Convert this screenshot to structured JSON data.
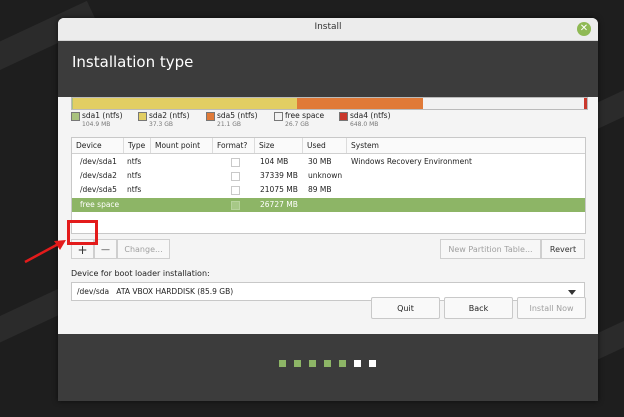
{
  "window": {
    "title": "Install"
  },
  "header": {
    "title": "Installation type"
  },
  "partition_bar": {
    "segments": [
      {
        "name": "sda1",
        "fraction": 0.0025,
        "color": "#a9c27e"
      },
      {
        "name": "sda2",
        "fraction": 0.4346,
        "color": "#e2ce63"
      },
      {
        "name": "sda5",
        "fraction": 0.2454,
        "color": "#e07a38"
      },
      {
        "name": "free",
        "fraction": 0.311,
        "color": "#f2f2f2"
      },
      {
        "name": "sda4",
        "fraction": 0.0065,
        "color": "#c9382c"
      }
    ]
  },
  "legend": [
    {
      "name": "sda1 (ntfs)",
      "size": "104.9 MB",
      "color": "#a9c27e"
    },
    {
      "name": "sda2 (ntfs)",
      "size": "37.3 GB",
      "color": "#e2ce63"
    },
    {
      "name": "sda5 (ntfs)",
      "size": "21.1 GB",
      "color": "#e07a38"
    },
    {
      "name": "free space",
      "size": "26.7 GB",
      "color": "#f2f2f2"
    },
    {
      "name": "sda4 (ntfs)",
      "size": "648.0 MB",
      "color": "#c9382c"
    }
  ],
  "table": {
    "headers": [
      "Device",
      "Type",
      "Mount point",
      "Format?",
      "Size",
      "Used",
      "System"
    ],
    "rows": [
      {
        "device": "/dev/sda1",
        "type": "ntfs",
        "mount": "",
        "size": "104 MB",
        "used": "30 MB",
        "system": "Windows Recovery Environment"
      },
      {
        "device": "/dev/sda2",
        "type": "ntfs",
        "mount": "",
        "size": "37339 MB",
        "used": "unknown",
        "system": ""
      },
      {
        "device": "/dev/sda5",
        "type": "ntfs",
        "mount": "",
        "size": "21075 MB",
        "used": "89 MB",
        "system": ""
      },
      {
        "device": "free space",
        "type": "",
        "mount": "",
        "size": "26727 MB",
        "used": "",
        "system": ""
      }
    ]
  },
  "toolbar": {
    "add": "+",
    "remove": "—",
    "change": "Change...",
    "new_table": "New Partition Table...",
    "revert": "Revert"
  },
  "bootloader": {
    "label": "Device for boot loader installation:",
    "device": "/dev/sda",
    "desc": "ATA VBOX HARDDISK (85.9 GB)"
  },
  "nav": {
    "quit": "Quit",
    "back": "Back",
    "install": "Install Now"
  },
  "progress": {
    "completed_steps": 5,
    "total_steps": 7,
    "done_color": "#8db566",
    "pending_color": "#ffffff"
  },
  "annotation": {
    "arrow_color": "#e31b1b"
  }
}
